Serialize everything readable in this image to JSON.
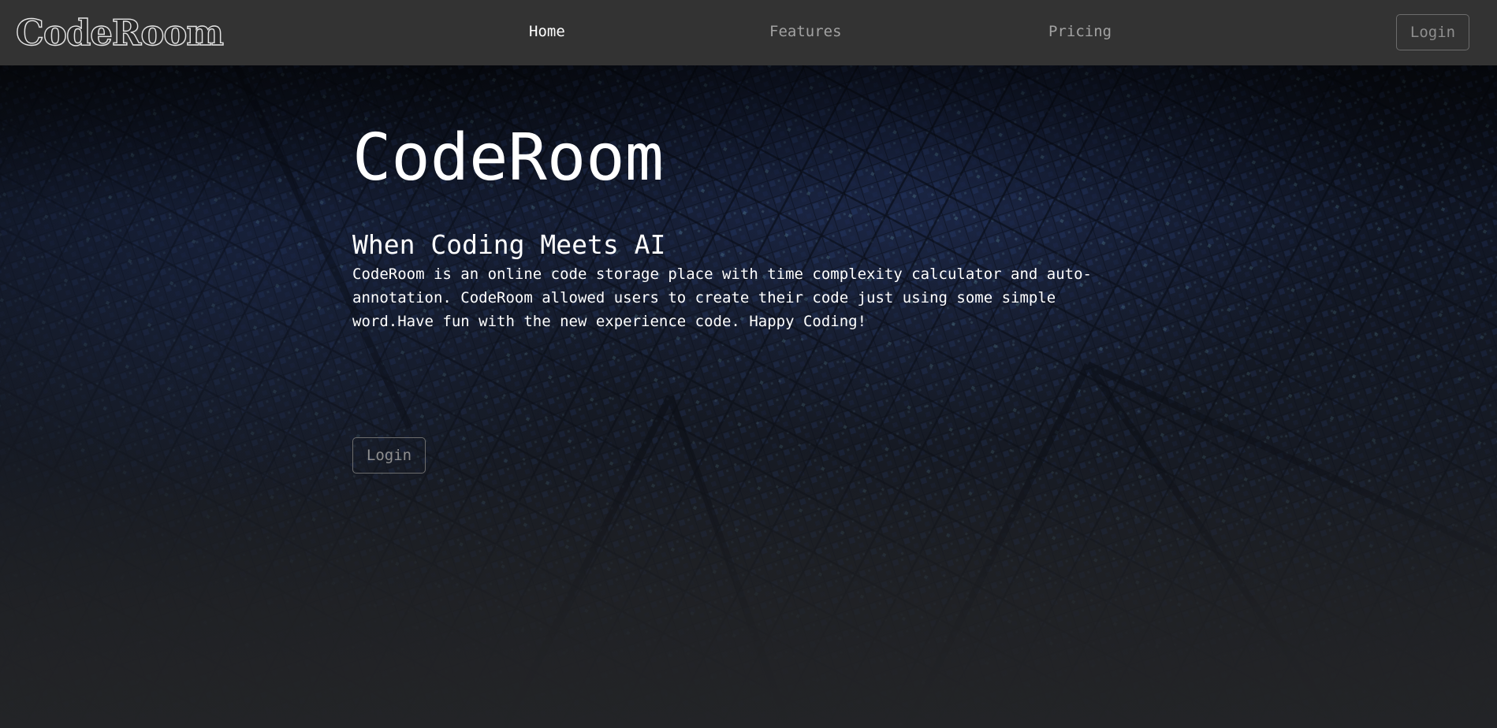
{
  "navbar": {
    "brand": "CodeRoom",
    "links": [
      {
        "label": "Home",
        "active": true
      },
      {
        "label": "Features",
        "active": false
      },
      {
        "label": "Pricing",
        "active": false
      }
    ],
    "login_label": "Login"
  },
  "hero": {
    "title": "CodeRoom",
    "subtitle": "When Coding Meets AI",
    "description": "CodeRoom is an online code storage place with time complexity calculator and auto-annotation. CodeRoom allowed users to create their code just using some simple word.Have fun with the new experience code. Happy Coding!",
    "login_label": "Login"
  },
  "colors": {
    "navbar_bg": "#333333",
    "nav_active": "#ffffff",
    "nav_inactive": "#a2a2a2",
    "button_border": "#6c6c6c",
    "hero_accent": "#2a3c70"
  }
}
